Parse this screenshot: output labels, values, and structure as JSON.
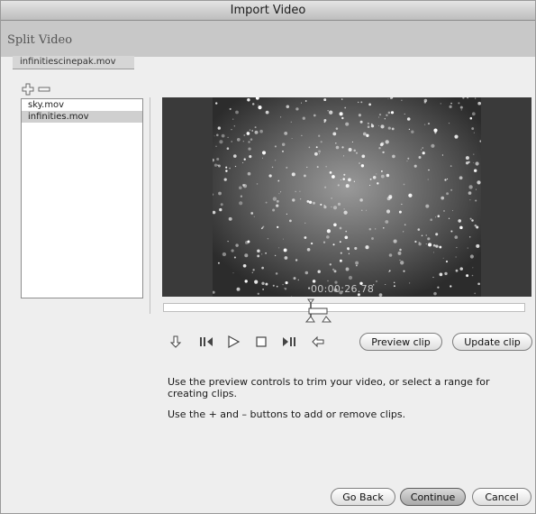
{
  "window": {
    "title": "Import Video"
  },
  "header": {
    "heading": "Split Video"
  },
  "file_tab": {
    "label": "infinitiescinepak.mov"
  },
  "clip_list": {
    "items": [
      {
        "label": "sky.mov",
        "selected": false
      },
      {
        "label": "infinities.mov",
        "selected": true
      }
    ]
  },
  "icons": {
    "add": "plus-icon",
    "remove": "minus-icon",
    "transport": [
      "go-to-start-icon",
      "step-back-icon",
      "play-icon",
      "stop-icon",
      "step-forward-icon",
      "go-to-end-icon"
    ]
  },
  "video": {
    "timecode": "00:00:26.78"
  },
  "clip_buttons": {
    "preview": "Preview clip",
    "update": "Update clip"
  },
  "instructions": {
    "line1": "Use the preview controls to trim your video, or select a range for creating clips.",
    "line2": "Use the + and – buttons to add or remove clips."
  },
  "footer": {
    "go_back": "Go Back",
    "continue": "Continue",
    "cancel": "Cancel"
  }
}
